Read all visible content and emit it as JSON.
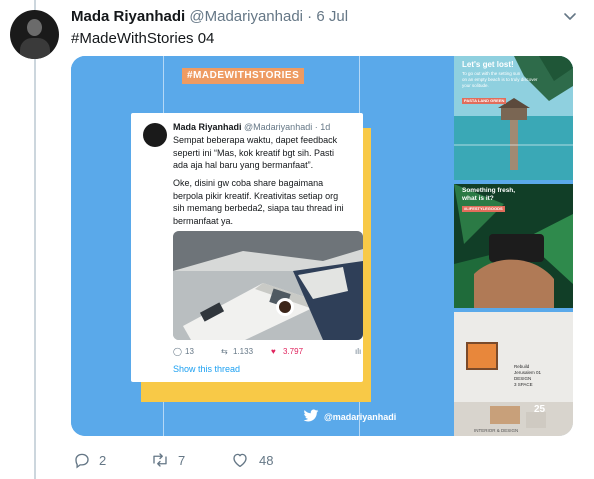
{
  "tweet": {
    "author_name": "Mada Riyanhadi",
    "author_handle": "@Madariyanhadi",
    "separator": "·",
    "date": "6 Jul",
    "text": "#MadeWithStories 04"
  },
  "media": {
    "badge": "#MADEWITHSTORIES",
    "brand_handle": "@madariyanhadi",
    "embedded_tweet": {
      "name": "Mada Riyanhadi",
      "handle_time": "@Madariyanhadi · 1d",
      "paragraph_1": [
        "Sempat beberapa waktu, dapet feedback",
        "seperti ini “Mas, kok kreatif bgt sih. Pasti",
        "ada aja hal baru yang bermanfaat”."
      ],
      "paragraph_2": [
        "Oke, disini gw coba share bagaimana",
        "berpola pikir kreatif. Kreativitas setiap org",
        "sih memang berbeda2, siapa tau thread ini",
        "bermanfaat ya."
      ],
      "replies": "13",
      "retweets": "1.133",
      "likes": "3.797",
      "show_thread": "Show this thread"
    },
    "thumb1": {
      "title": "Let's get lost!",
      "subtitle": [
        "To go out with the setting sun",
        "on an empty beach is to truly discover",
        "your solitude."
      ],
      "tag": "PASTA LAND GREEN"
    },
    "thumb2": {
      "title": [
        "Something fresh,",
        "what is it?"
      ],
      "tag": "#LIFESTYLEGOODS"
    },
    "thumb3": {
      "sign": [
        "Rebuild",
        "Jerusalem 01",
        "DESIGN",
        "3 SPACE"
      ],
      "number": "25",
      "footer": "INTERIOR & DESIGN"
    }
  },
  "actions": {
    "replies": "2",
    "retweets": "7",
    "likes": "48"
  },
  "colors": {
    "media_bg": "#5aa9ea",
    "card_accent": "#f8c947",
    "badge": "#ee9b62",
    "link": "#1da1f2",
    "heart": "#e0245e"
  }
}
